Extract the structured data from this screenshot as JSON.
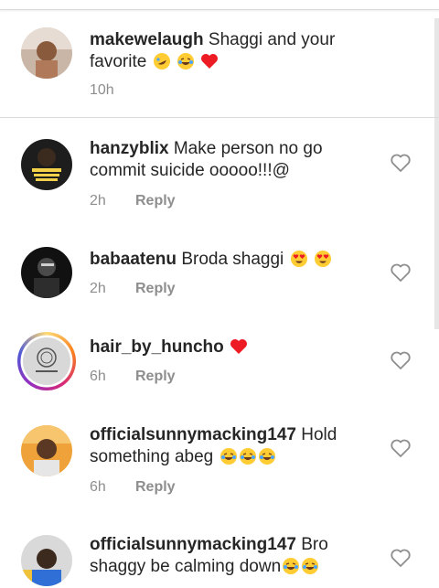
{
  "caption": {
    "username": "makewelaugh",
    "text": "Shaggi and your favorite",
    "time": "10h",
    "emojis": [
      "rofl-emoji",
      "joy-emoji",
      "red-heart-emoji"
    ]
  },
  "comments": [
    {
      "username": "hanzyblix",
      "text": "Make person no go commit suicide ooooo!!!@",
      "time": "2h",
      "reply": "Reply",
      "emojis": []
    },
    {
      "username": "babaatenu",
      "text": "Broda shaggi",
      "time": "2h",
      "reply": "Reply",
      "emojis": [
        "heart-eyes-emoji",
        "heart-eyes-emoji"
      ]
    },
    {
      "username": "hair_by_huncho",
      "text": "",
      "time": "6h",
      "reply": "Reply",
      "emojis": [
        "red-heart-emoji"
      ]
    },
    {
      "username": "officialsunnymacking147",
      "text": "Hold something abeg",
      "time": "6h",
      "reply": "Reply",
      "emojis": [
        "joy-emoji",
        "joy-emoji",
        "joy-emoji"
      ]
    },
    {
      "username": "officialsunnymacking147",
      "text": "Bro shaggy be calming down",
      "time": "",
      "reply": "",
      "emojis": [
        "joy-emoji",
        "joy-emoji"
      ]
    }
  ],
  "colors": {
    "text": "#262626",
    "meta": "#8e8e8e",
    "divider": "#dbdbdb",
    "like_outline": "#8e8e8e",
    "heart": "#ed1c24",
    "emoji_yellow": "#ffcc33"
  }
}
